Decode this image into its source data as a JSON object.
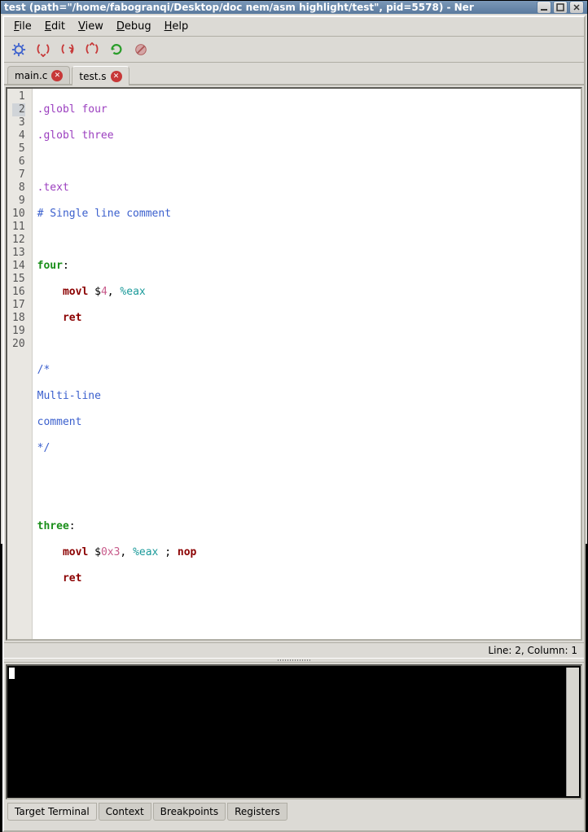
{
  "window": {
    "title": "test (path=\"/home/fabogranqi/Desktop/doc nem/asm highlight/test\", pid=5578) - Ner"
  },
  "menu": {
    "file": "File",
    "edit": "Edit",
    "view": "View",
    "debug": "Debug",
    "help": "Help"
  },
  "icons": {
    "gear": "gear-icon",
    "brk1": "curly-arrow-red-icon",
    "brk2": "curly-arrow-red-right-icon",
    "brk3": "curly-arrow-red-single-icon",
    "reload": "reload-green-icon",
    "stop": "stop-icon"
  },
  "tabs": [
    {
      "label": "main.c",
      "active": false
    },
    {
      "label": "test.s",
      "active": true
    }
  ],
  "code": {
    "lines": {
      "1": ".globl four",
      "2": ".globl three",
      "3": "",
      "4": ".text",
      "5": "# Single line comment",
      "6": "",
      "7a": "four",
      "7b": ":",
      "8a": "movl",
      "8b": "$",
      "8c": "4",
      "8d": ", ",
      "8e": "%eax",
      "9": "ret",
      "10": "",
      "11": "/*",
      "12": "Multi-line",
      "13": "comment",
      "14": "*/",
      "15": "",
      "16": "",
      "17a": "three",
      "17b": ":",
      "18a": "movl",
      "18b": "$",
      "18c": "0x3",
      "18d": ", ",
      "18e": "%eax",
      "18f": " ; ",
      "18g": "nop",
      "19": "ret",
      "20": ""
    }
  },
  "linenumbers": {
    "1": "1",
    "2": "2",
    "3": "3",
    "4": "4",
    "5": "5",
    "6": "6",
    "7": "7",
    "8": "8",
    "9": "9",
    "10": "10",
    "11": "11",
    "12": "12",
    "13": "13",
    "14": "14",
    "15": "15",
    "16": "16",
    "17": "17",
    "18": "18",
    "19": "19",
    "20": "20"
  },
  "status": {
    "text": "Line: 2, Column: 1"
  },
  "bottom_tabs": {
    "terminal": "Target Terminal",
    "context": "Context",
    "breakpoints": "Breakpoints",
    "registers": "Registers"
  },
  "cursor_line": 2
}
